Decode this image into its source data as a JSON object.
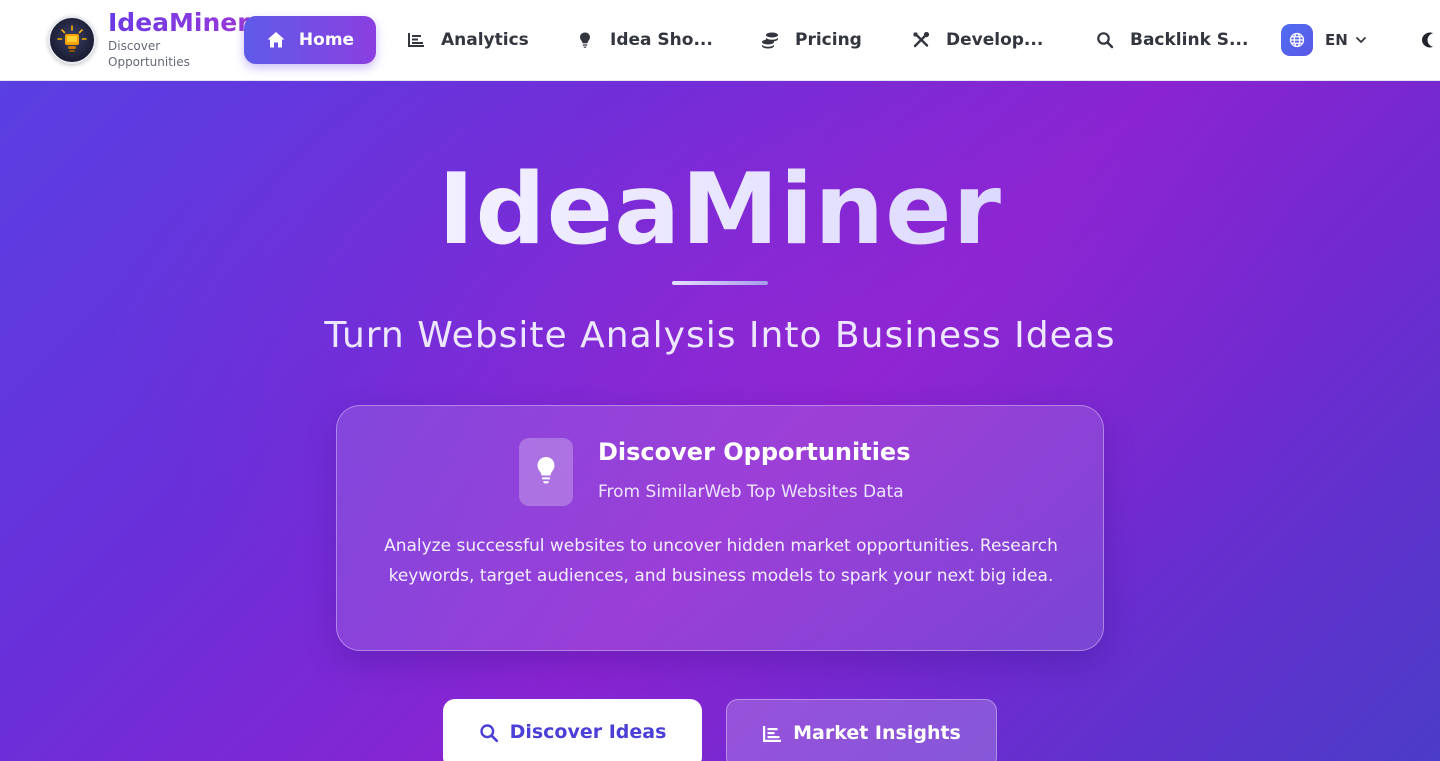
{
  "brand": {
    "name": "IdeaMiner",
    "tagline": "Discover Opportunities"
  },
  "nav": {
    "items": [
      {
        "label": "Home",
        "icon": "home-icon",
        "active": true
      },
      {
        "label": "Analytics",
        "icon": "chart-icon",
        "active": false
      },
      {
        "label": "Idea Sho...",
        "icon": "lightbulb-icon",
        "active": false
      },
      {
        "label": "Pricing",
        "icon": "coins-icon",
        "active": false
      },
      {
        "label": "Develop...",
        "icon": "tools-icon",
        "active": false
      },
      {
        "label": "Backlink S...",
        "icon": "search-icon",
        "active": false
      }
    ],
    "language": "EN",
    "theme_toggle_icon": "moon-icon"
  },
  "hero": {
    "title": "IdeaMiner",
    "subtitle": "Turn Website Analysis Into Business Ideas",
    "card": {
      "icon": "lightbulb-icon",
      "title": "Discover Opportunities",
      "subtitle": "From SimilarWeb Top Websites Data",
      "description": "Analyze successful websites to uncover hidden market opportunities. Research keywords, target audiences, and business models to spark your next big idea."
    },
    "primary_button": {
      "label": "Discover Ideas",
      "icon": "search-icon"
    },
    "secondary_button": {
      "label": "Market Insights",
      "icon": "chart-icon"
    }
  },
  "colors": {
    "accent": "#6a3be6",
    "hero_gradient_start": "#5a3fe2",
    "hero_gradient_mid": "#8a24d2",
    "hero_gradient_end": "#4b3cc8",
    "primary_button_text": "#4b3fd8"
  }
}
